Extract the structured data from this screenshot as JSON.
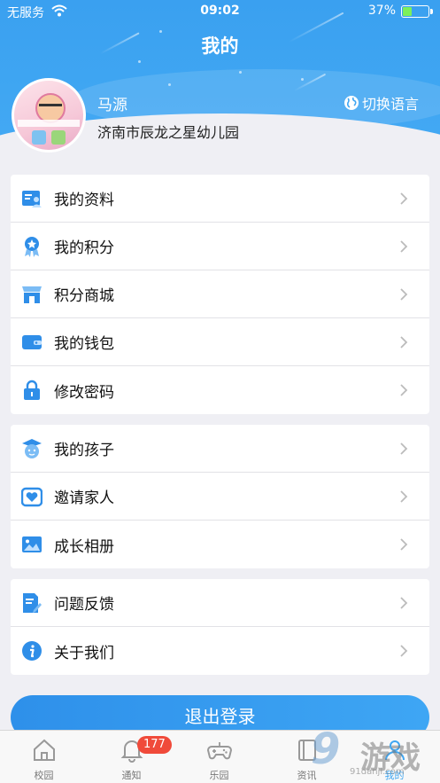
{
  "status_bar": {
    "carrier": "无服务",
    "time": "09:02",
    "battery_pct": "37%",
    "battery_level": 0.37
  },
  "header": {
    "title": "我的"
  },
  "profile": {
    "name": "马源",
    "school": "济南市辰龙之星幼儿园",
    "lang_button": "切换语言"
  },
  "menu_groups": [
    {
      "items": [
        {
          "label": "我的资料",
          "icon": "profile-card-icon"
        },
        {
          "label": "我的积分",
          "icon": "medal-icon"
        },
        {
          "label": "积分商城",
          "icon": "store-icon"
        },
        {
          "label": "我的钱包",
          "icon": "wallet-icon"
        },
        {
          "label": "修改密码",
          "icon": "lock-icon"
        }
      ]
    },
    {
      "items": [
        {
          "label": "我的孩子",
          "icon": "child-graduate-icon"
        },
        {
          "label": "邀请家人",
          "icon": "heart-invite-icon"
        },
        {
          "label": "成长相册",
          "icon": "photo-album-icon"
        }
      ]
    },
    {
      "items": [
        {
          "label": "问题反馈",
          "icon": "feedback-edit-icon"
        },
        {
          "label": "关于我们",
          "icon": "info-icon"
        }
      ]
    }
  ],
  "logout_label": "退出登录",
  "tabbar": [
    {
      "label": "校园",
      "icon": "home-icon"
    },
    {
      "label": "通知",
      "icon": "bell-icon",
      "badge": "177"
    },
    {
      "label": "乐园",
      "icon": "gamepad-icon"
    },
    {
      "label": "资讯",
      "icon": "book-icon"
    },
    {
      "label": "我的",
      "icon": "user-icon"
    }
  ],
  "watermark": {
    "number": "9",
    "text": "游戏",
    "url": "91danji.com"
  },
  "colors": {
    "primary": "#3fa6f2",
    "icon_blue": "#2f8ee8",
    "badge_red": "#f04a3a",
    "background": "#efeff4"
  }
}
